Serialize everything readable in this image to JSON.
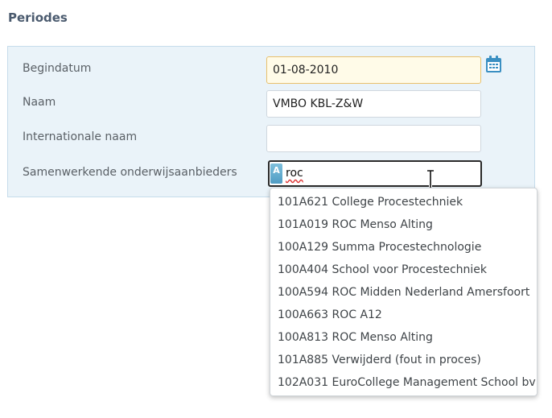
{
  "section": {
    "title": "Periodes"
  },
  "form": {
    "begindatum": {
      "label": "Begindatum",
      "value": "01-08-2010"
    },
    "naam": {
      "label": "Naam",
      "value": "VMBO KBL-Z&W"
    },
    "internationale_naam": {
      "label": "Internationale naam",
      "value": ""
    },
    "samenwerkende": {
      "label": "Samenwerkende onderwijsaanbieders",
      "value": "roc",
      "badge": "A"
    }
  },
  "icons": {
    "calendar": "calendar-icon",
    "cursor": "text-cursor-icon"
  },
  "dropdown": {
    "options": [
      "101A621 College Procestechniek",
      "101A019 ROC Menso Alting",
      "100A129 Summa Procestechnologie",
      "100A404 School voor Procestechniek",
      "100A594 ROC Midden Nederland Amersfoort",
      "100A663 ROC A12",
      "100A813 ROC Menso Alting",
      "101A885 Verwijderd (fout in proces)",
      "102A031 EuroCollege Management School bv"
    ]
  },
  "colors": {
    "panel_bg": "#eaf3f9",
    "accent": "#4f9cc4",
    "focus_border": "#e8c06b"
  }
}
